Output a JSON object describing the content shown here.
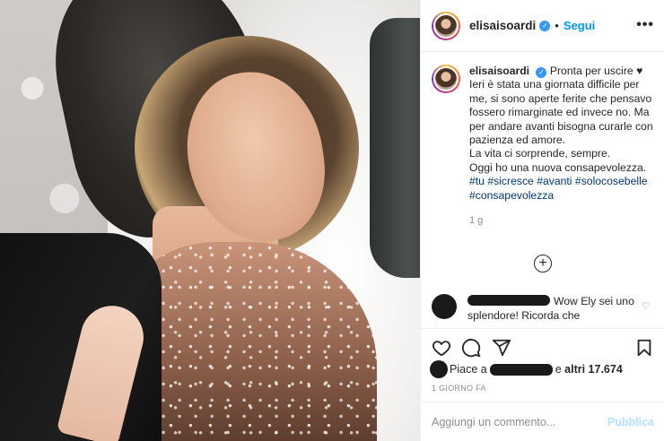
{
  "post": {
    "username": "elisaisoardi",
    "verified": true,
    "follow_label": "Segui",
    "separator": "•",
    "more_icon": "more-options-icon"
  },
  "caption": {
    "username": "elisaisoardi",
    "first_line": "Pronta per uscire",
    "heart": "♥",
    "body_lines": [
      "Ieri è stata una giornata difficile per me, si sono aperte ferite che pensavo fossero rimarginate ed invece no. Ma per andare avanti bisogna curarle con pazienza ed amore.",
      "La vita ci sorprende, sempre.",
      "Oggi ho una nuova consapevolezza."
    ],
    "hashtags": [
      "#tu",
      "#sicresce",
      "#avanti",
      "#solocosebelle",
      "#consapevolezza"
    ],
    "time_ago": "1 g"
  },
  "comment": {
    "text": "Wow Ely sei uno splendore! Ricorda che"
  },
  "likes": {
    "prefix": "Piace a",
    "suffix": "e",
    "count_text": "altri 17.674"
  },
  "date_label": "1 GIORNO FA",
  "comment_box": {
    "placeholder": "Aggiungi un commento...",
    "publish_label": "Pubblica"
  },
  "colors": {
    "link": "#0095f6",
    "hashtag": "#00376b",
    "muted": "#8e8e8e",
    "publish_disabled": "#b2dffc",
    "verified": "#3897f0"
  }
}
